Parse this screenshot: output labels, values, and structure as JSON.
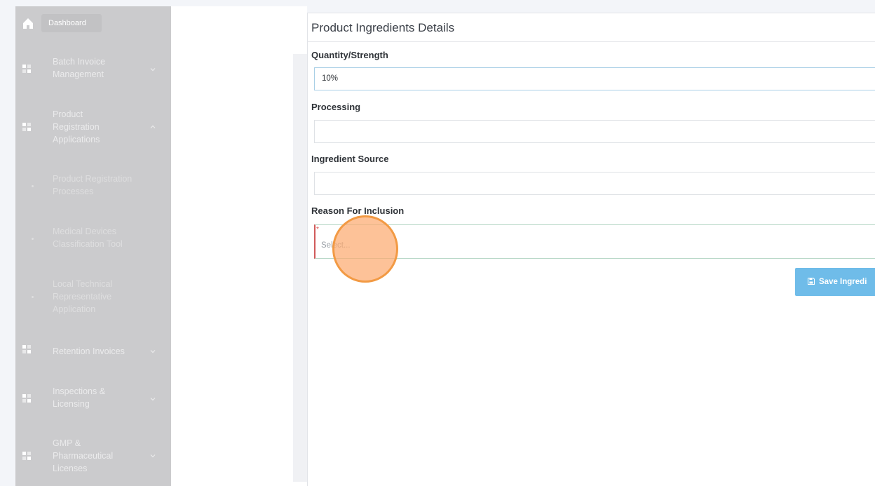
{
  "sidebar": {
    "home_label": "Dashboard",
    "items": [
      {
        "label": "Batch Invoice Management",
        "expanded": false
      },
      {
        "label": "Product Registration Applications",
        "expanded": true
      },
      {
        "label": "Retention Invoices",
        "expanded": false
      },
      {
        "label": "Inspections & Licensing",
        "expanded": false
      },
      {
        "label": "GMP & Pharmaceutical Licenses",
        "expanded": false
      }
    ],
    "subitems": [
      {
        "label": "Product Registration Processes"
      },
      {
        "label": "Medical Devices Classification Tool"
      },
      {
        "label": "Local Technical Representative Application"
      }
    ]
  },
  "modal": {
    "title": "Product Ingredients Details",
    "fields": [
      {
        "label": "Quantity/Strength",
        "value": "10%"
      },
      {
        "label": "Processing",
        "value": ""
      },
      {
        "label": "Ingredient Source",
        "value": ""
      },
      {
        "label": "Reason For Inclusion",
        "placeholder": "Select...",
        "required_marker": "*"
      }
    ],
    "save_label": "Save Ingredi"
  },
  "colors": {
    "sidebar_bg": "#cbcbcd",
    "primary_button": "#6fbce9",
    "click_marker": "#f29a44",
    "required": "#d9534f"
  }
}
